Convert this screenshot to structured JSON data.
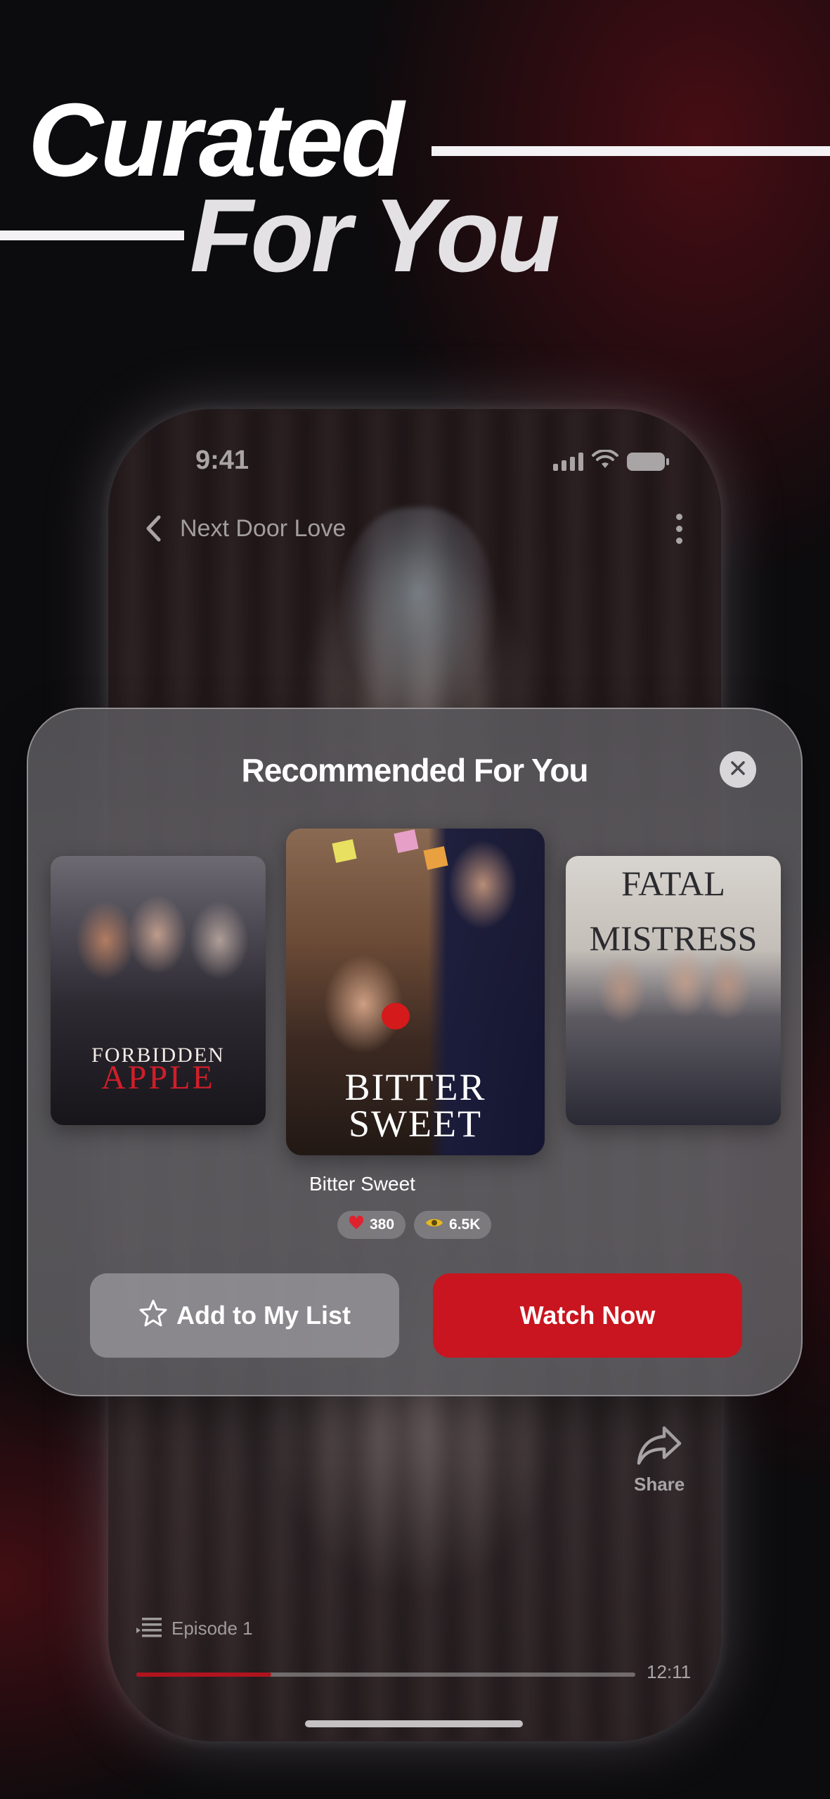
{
  "headline": {
    "line1": "Curated",
    "line2": "For You"
  },
  "phone": {
    "status_time": "9:41",
    "nav_title": "Next Door Love",
    "share_label": "Share",
    "episode_label": "Episode 1",
    "time_label": "12:11",
    "playback_progress": 0.27
  },
  "modal": {
    "title": "Recommended For You",
    "posters": [
      {
        "title_top": "FORBIDDEN",
        "title_bottom": "APPLE"
      },
      {
        "title_top": "BITTER",
        "title_bottom": "SWEET"
      },
      {
        "title_top": "FATAL",
        "title_bottom": "MISTRESS"
      }
    ],
    "selected_name": "Bitter Sweet",
    "likes": "380",
    "views": "6.5K",
    "add_label": "Add to My List",
    "watch_label": "Watch Now"
  },
  "colors": {
    "accent_red": "#c9151f",
    "progress_red": "#b0141f"
  },
  "icons": [
    "back-chevron-icon",
    "more-vertical-icon",
    "signal-icon",
    "wifi-icon",
    "battery-icon",
    "close-icon",
    "heart-icon",
    "eye-icon",
    "star-outline-icon",
    "share-icon",
    "episode-list-icon"
  ]
}
